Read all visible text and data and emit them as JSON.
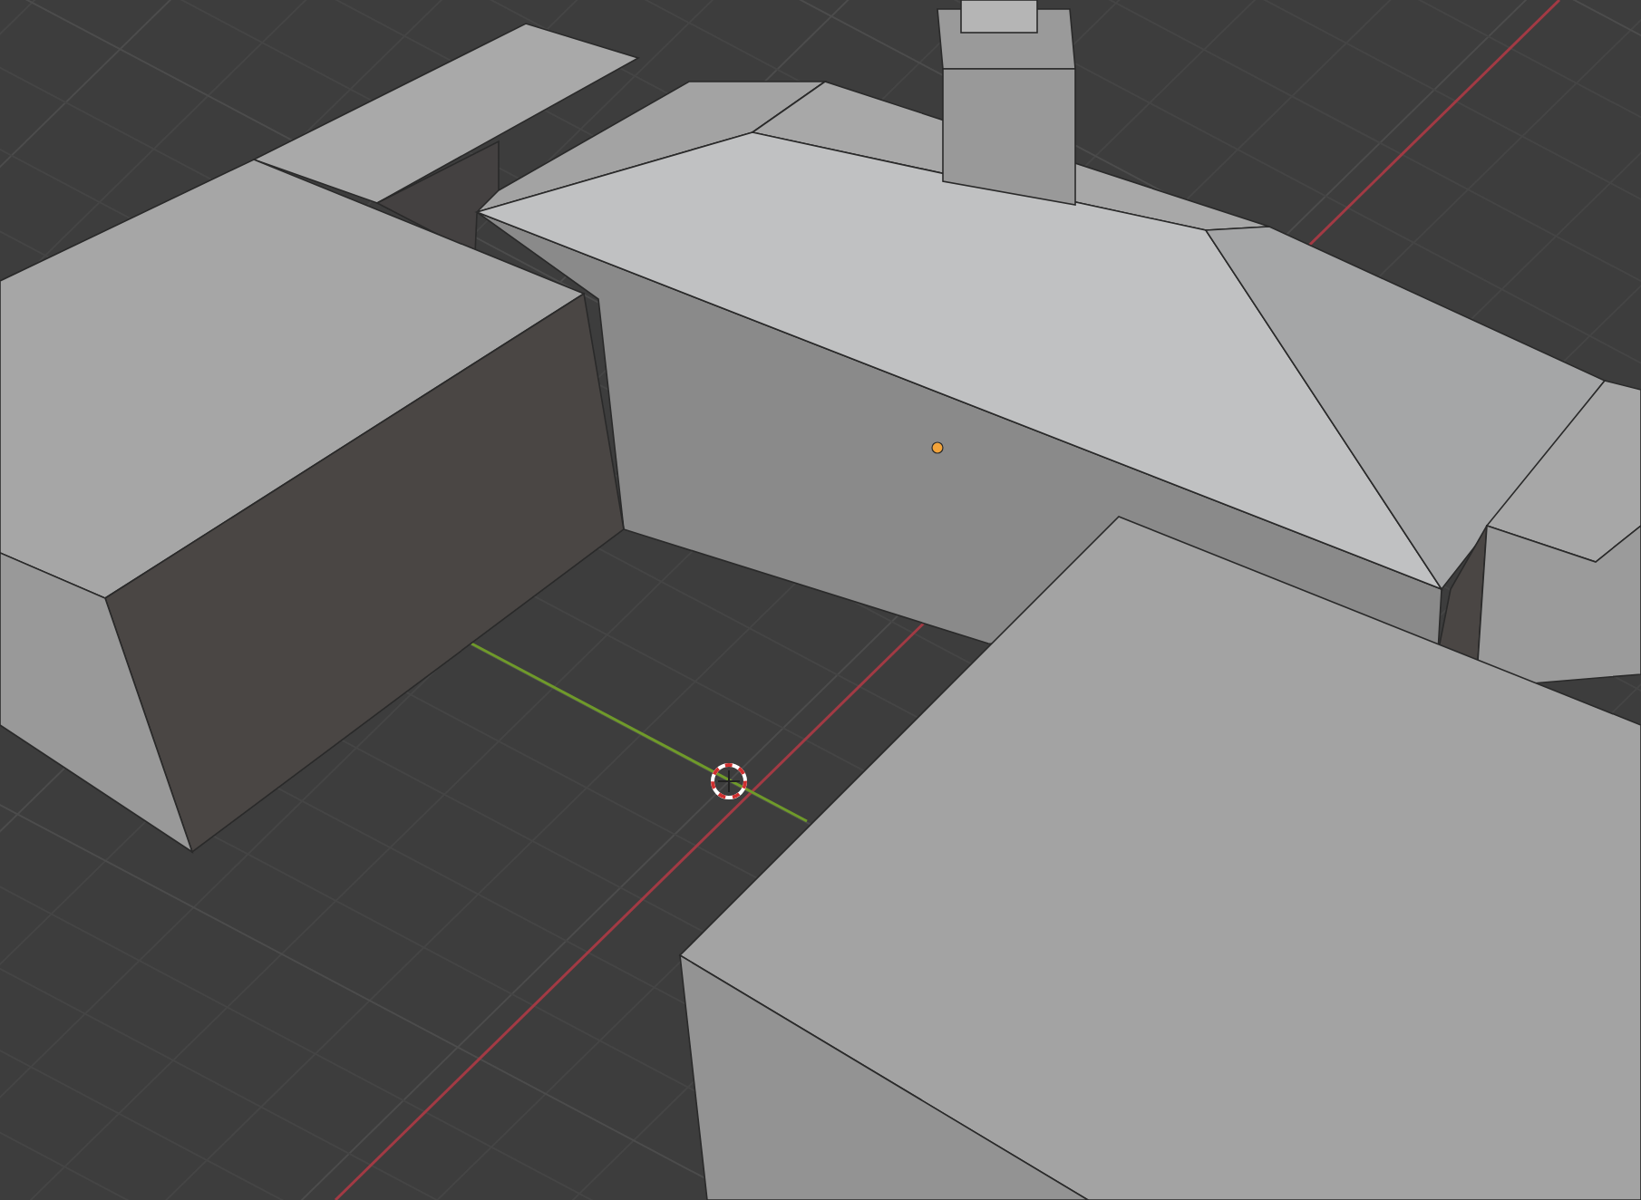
{
  "viewport": {
    "show_grid": true,
    "show_axes": true,
    "show_origin": true,
    "show_cursor": true
  }
}
